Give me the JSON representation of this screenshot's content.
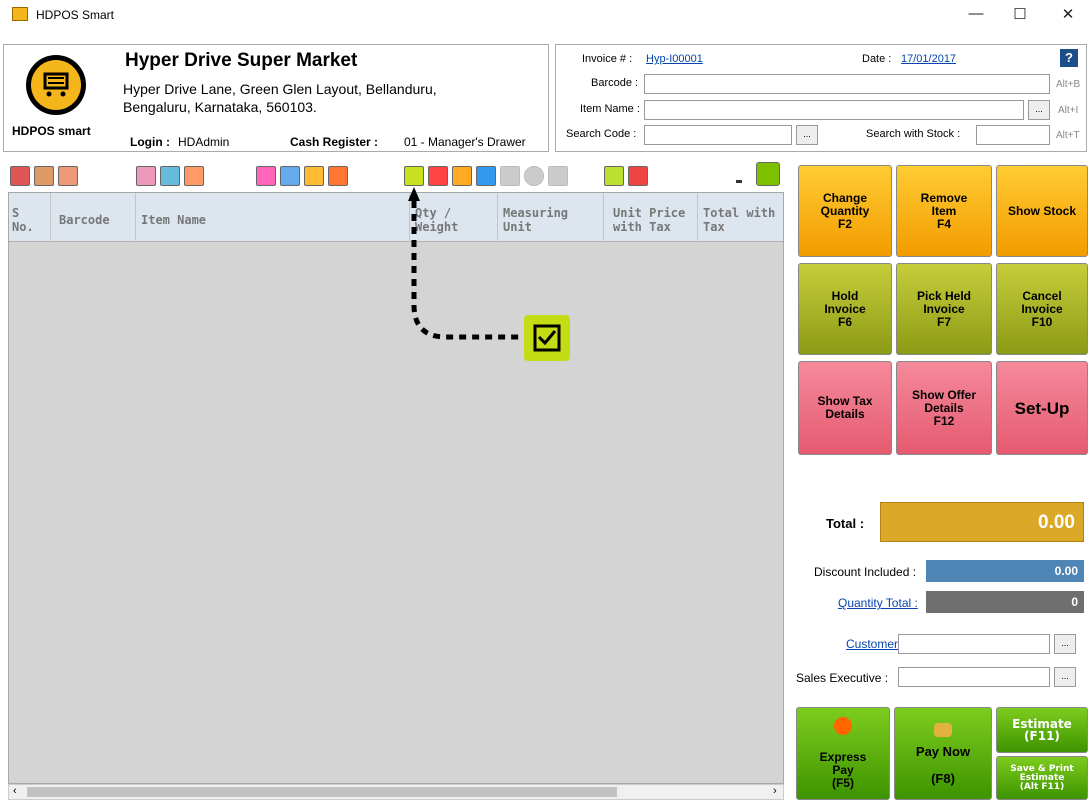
{
  "window": {
    "title": "HDPOS Smart",
    "minimize": "—",
    "maximize": "☐",
    "close": "✕"
  },
  "store": {
    "logo_text": "HDPOS smart",
    "name": "Hyper Drive Super Market",
    "address_line1": "Hyper Drive Lane, Green Glen Layout, Bellanduru,",
    "address_line2": "Bengaluru, Karnataka, 560103.",
    "login_label": "Login :",
    "login_value": "HDAdmin",
    "register_label": "Cash Register :",
    "register_value": "01 - Manager's Drawer"
  },
  "invoice": {
    "invoice_label": "Invoice # :",
    "invoice_value": "Hyp-I00001",
    "date_label": "Date :",
    "date_value": "17/01/2017",
    "barcode_label": "Barcode :",
    "barcode_hint": "Alt+B",
    "item_name_label": "Item Name :",
    "item_name_hint": "Alt+I",
    "search_code_label": "Search Code :",
    "search_stock_label": "Search with Stock :",
    "search_stock_hint": "Alt+T",
    "help": "?",
    "ellipsis": "..."
  },
  "grid": {
    "columns": [
      "S\nNo.",
      "Barcode",
      "Item Name",
      "Qty /\nWeight",
      "Measuring\nUnit",
      "Unit Price\nwith Tax",
      "Total with\nTax"
    ]
  },
  "functions": {
    "change_qty": "Change\nQuantity\nF2",
    "remove_item": "Remove\nItem\nF4",
    "show_stock": "Show Stock",
    "hold": "Hold\nInvoice\nF6",
    "pick_held": "Pick Held\nInvoice\nF7",
    "cancel": "Cancel\nInvoice\nF10",
    "tax": "Show Tax\nDetails",
    "offer": "Show Offer\nDetails\nF12",
    "setup": "Set-Up"
  },
  "totals": {
    "total_label": "Total :",
    "total_value": "0.00",
    "discount_label": "Discount Included :",
    "discount_value": "0.00",
    "qty_label": "Quantity Total :",
    "qty_value": "0",
    "customer_label": "Customer :",
    "sales_exec_label": "Sales Executive :"
  },
  "actions": {
    "express": "Express\nPay\n(F5)",
    "paynow": "Pay Now",
    "paynow_key": "(F8)",
    "estimate": "Estimate\n(F11)",
    "save_print": "Save & Print\nEstimate\n(Alt F11)"
  },
  "colors": {
    "total": "#dba927",
    "discount": "#4e85b5",
    "qty": "#6f6f6f",
    "orange": "#f7b000",
    "olive": "#a8b22a",
    "pink": "#ea6b80",
    "green": "#58ad0d"
  }
}
